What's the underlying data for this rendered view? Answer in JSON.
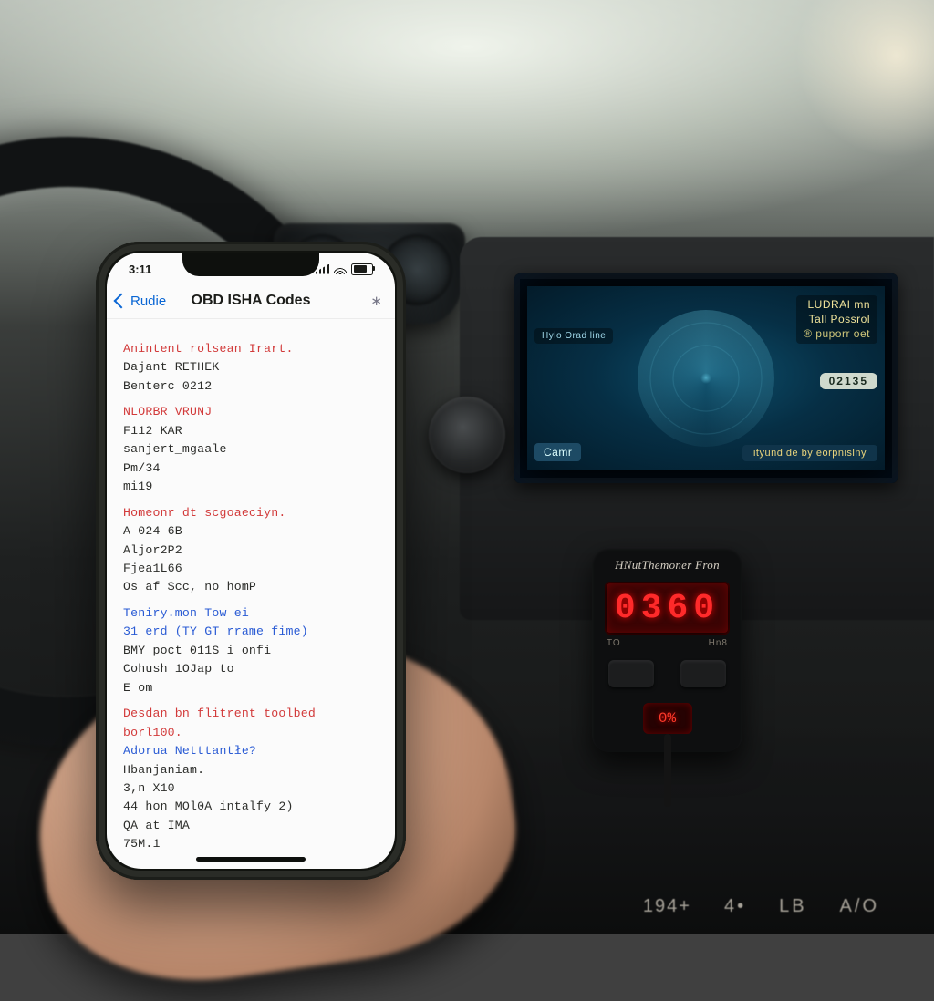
{
  "phone": {
    "statusbar": {
      "time": "3:11"
    },
    "nav": {
      "back_label": "Rudie",
      "title": "OBD ISHA Codes",
      "share_glyph": "∗"
    },
    "groups": [
      {
        "header": "Anintent rolsean Irart.",
        "lines": [
          "Dajant RETHEK",
          "Benterc 0212"
        ]
      },
      {
        "header": "NLORBR VRUNJ",
        "lines": [
          "F112 KAR",
          "sanjert_mgaale",
          "Pm/34",
          "mi19"
        ]
      },
      {
        "header": "Homeonr dt scgoaeciyn.",
        "lines": [
          "A 024 6B",
          "Aljor2P2",
          "Fjea1L66",
          "Os af $cc, no homP"
        ]
      },
      {
        "header": "Teniry.mon Tow ei",
        "lines": [
          "31 erd (TY GT rrame fime)",
          "BMY poct 011S  i onfi",
          "Cohush 1OJap to",
          "E om"
        ],
        "header_color": "blue",
        "line1_color": "blue"
      },
      {
        "header": "Desdan bn flitrent toolbed borl100.",
        "lines": [
          "Adorua Netttantłe?",
          "Hbanjaniam.",
          "3,n X10",
          "44 hon MOl0A intalfy 2)",
          "QA at  IMA",
          "75M.1"
        ],
        "line1_color": "blue"
      }
    ]
  },
  "infotainment": {
    "top_right_1": "LUDRAI mn",
    "top_right_2": "Tall Possrol",
    "top_right_3": "® puporr oet",
    "badge": "02135",
    "bottom_left": "Camr",
    "bottom_right": "ityund de by eorpnislny",
    "left_small": "Hylo Orad\nline"
  },
  "obd": {
    "brand": "HNutThemoner Fron",
    "main_readout": "0360",
    "sub_left": "TO",
    "sub_right": "Hn8",
    "mini_readout": "0%"
  },
  "dash_buttons": {
    "left": "194+",
    "m1": "4•",
    "m2": "LB",
    "m3": "A/O"
  }
}
